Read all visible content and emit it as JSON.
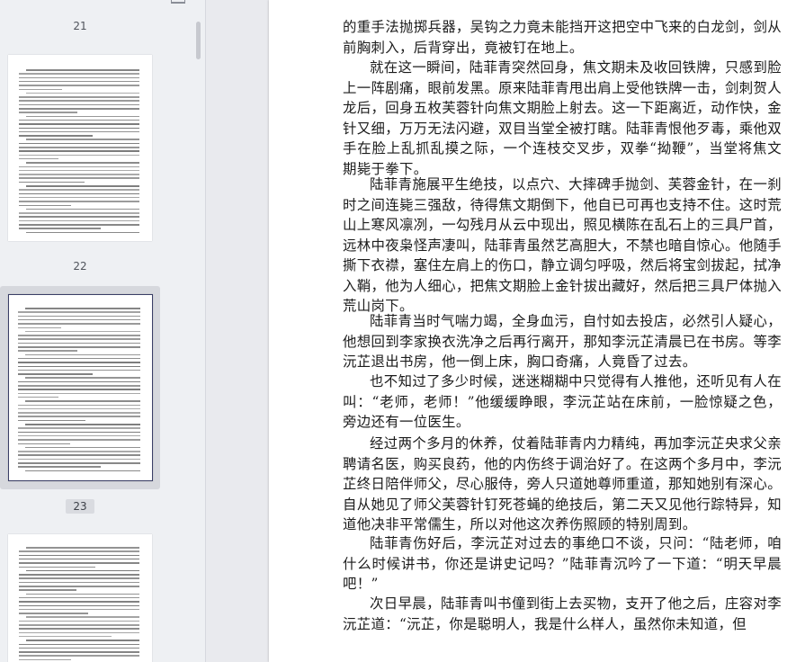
{
  "sidebar": {
    "thumbnails": [
      {
        "page_label": "21",
        "active": false
      },
      {
        "page_label": "22",
        "active": true
      },
      {
        "page_label": "23",
        "active": false
      }
    ]
  },
  "document": {
    "paragraphs": [
      {
        "indent": false,
        "text": "的重手法抛掷兵器，吴钩之力竟未能挡开这把空中飞来的白龙剑，剑从前胸刺入，后背穿出，竟被钉在地上。"
      },
      {
        "indent": true,
        "text": "就在这一瞬间，陆菲青突然回身，焦文期未及收回铁牌，只感到脸上一阵剧痛，眼前发黑。原来陆菲青甩出肩上受他铁牌一击，剑刺贺人龙后，回身五枚芙蓉针向焦文期脸上射去。这一下距离近，动作快，金针又细，万万无法闪避，双目当堂全被打瞎。陆菲青恨他歹毒，乘他双手在脸上乱抓乱摸之际，一个连枝交叉步，双拳“拗鞭”，当堂将焦文期毙于拳下。"
      },
      {
        "indent": true,
        "text": "陆菲青施展平生绝技，以点穴、大摔碑手抛剑、芙蓉金针，在一刹时之间连毙三强敌，待得焦文期倒下，他自已可再也支持不住。这时荒山上寒风凛冽，一勾残月从云中现出，照见横陈在乱石上的三具尸首，远林中夜枭怪声凄叫，陆菲青虽然艺高胆大，不禁也暗自惊心。他随手撕下衣襟，塞住左肩上的伤口，静立调匀呼吸，然后将宝剑拔起，拭净入鞘，他为人细心，把焦文期脸上金针拔出藏好，然后把三具尸体抛入荒山岗下。"
      },
      {
        "indent": true,
        "text": "陆菲青当时气喘力竭，全身血污，自忖如去投店，必然引人疑心，他想回到李家换衣洗净之后再行离开，那知李沅芷清晨已在书房。等李沅芷退出书房，他一倒上床，胸口奇痛，人竟昏了过去。"
      },
      {
        "indent": true,
        "text": "也不知过了多少时候，迷迷糊糊中只觉得有人推他，还听见有人在叫：“老师，老师！”他缓缓睁眼，李沅芷站在床前，一脸惊疑之色，旁边还有一位医生。"
      },
      {
        "indent": true,
        "text": "经过两个多月的休养，仗着陆菲青内力精纯，再加李沅芷央求父亲聘请名医，购买良药，他的内伤终于调治好了。在这两个多月中，李沅芷终日陪伴师父，尽心服侍，旁人只道她尊师重道，那知她别有深心。自从她见了师父芙蓉针钉死苍蝇的绝技后，第二天又见他行踪特异，知道他决非平常儒生，所以对他这次养伤照顾的特别周到。"
      },
      {
        "indent": true,
        "text": "陆菲青伤好后，李沅芷对过去的事绝口不谈，只问：“陆老师，咱什么时候讲书，你还是讲史记吗？”陆菲青沉吟了一下道：“明天早晨吧！”"
      },
      {
        "indent": true,
        "text": "次日早晨，陆菲青叫书僮到街上去买物，支开了他之后，庄容对李沅芷道：“沅芷，你是聪明人，我是什么样人，虽然你未知道，但"
      }
    ]
  }
}
